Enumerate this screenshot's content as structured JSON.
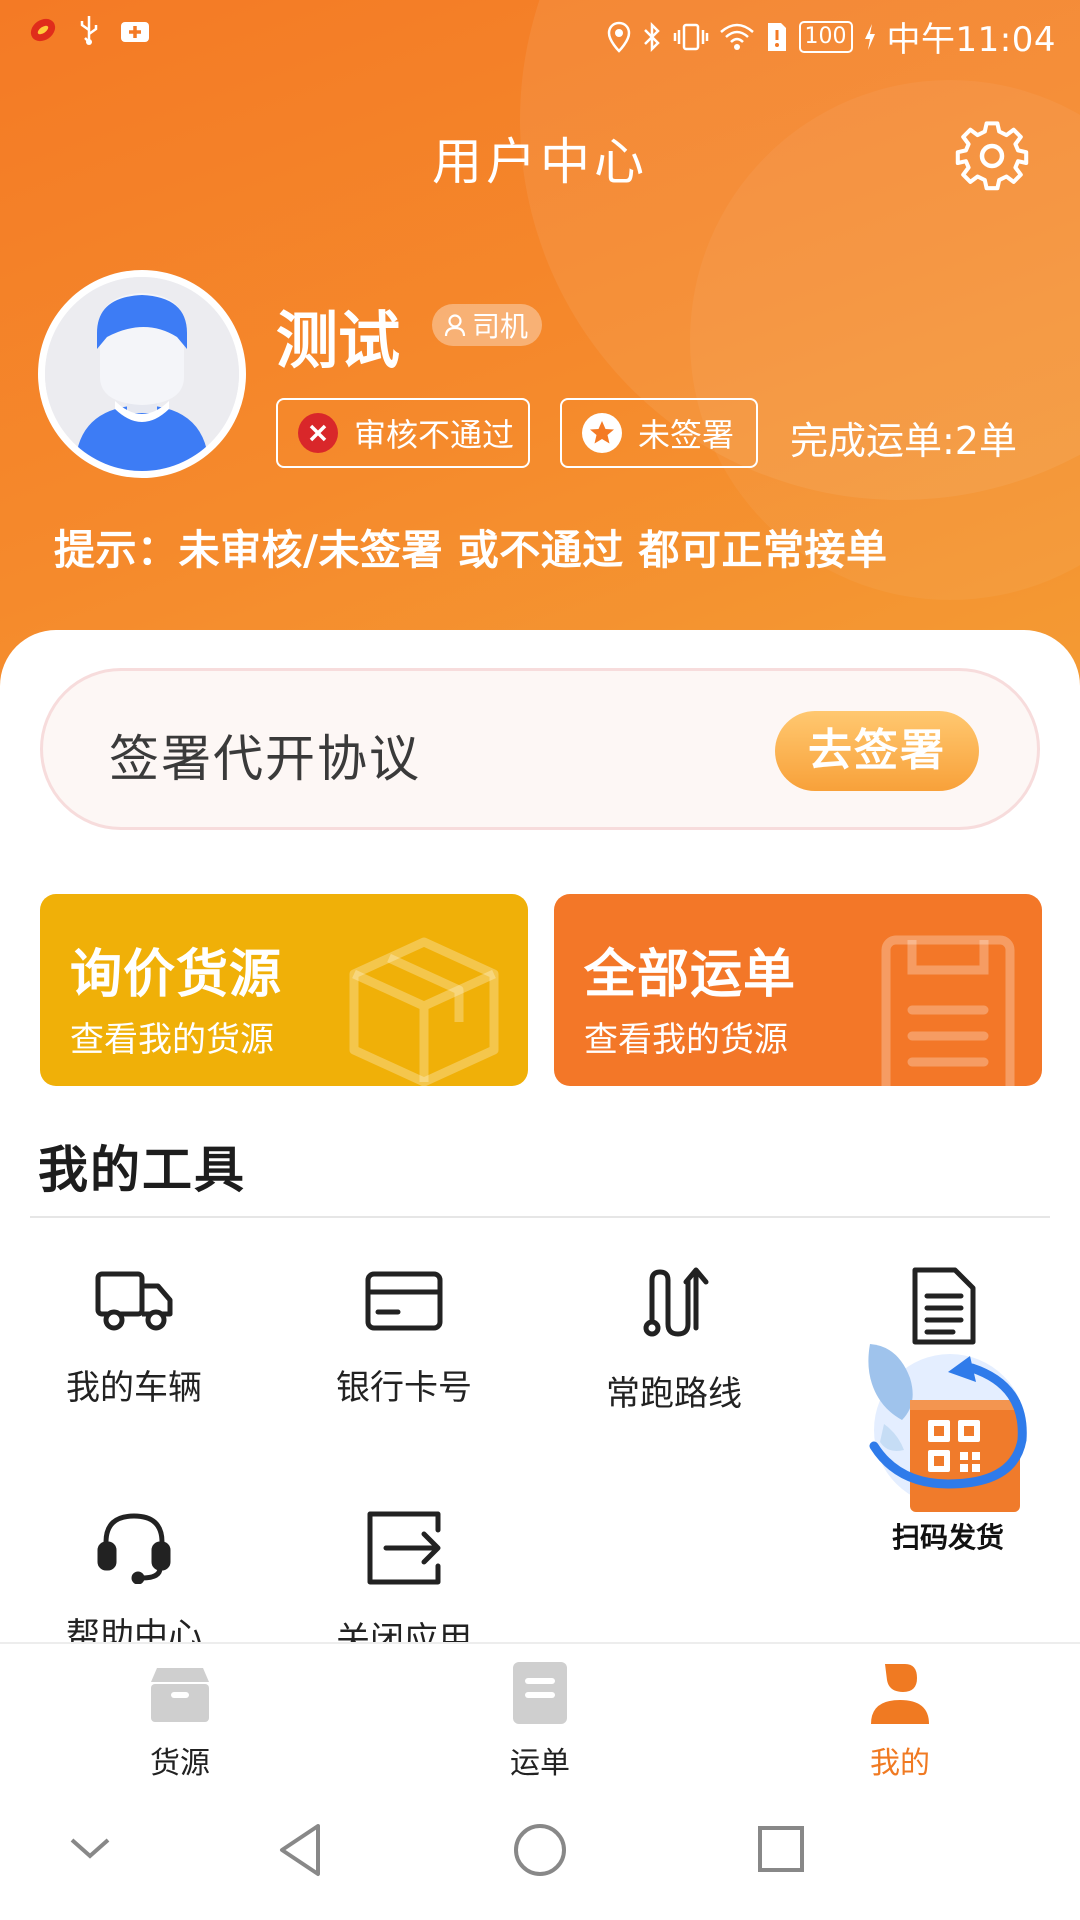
{
  "status_bar": {
    "battery": "100",
    "time": "中午11:04"
  },
  "header": {
    "title": "用户中心"
  },
  "profile": {
    "name": "测试",
    "role": "司机",
    "review_status": "审核不通过",
    "sign_status": "未签署",
    "completed_orders": "完成运单:2单",
    "tip": "提示：未审核/未签署 或不通过 都可正常接单"
  },
  "agreement": {
    "label": "签署代开协议",
    "button": "去签署"
  },
  "cards": [
    {
      "title": "询价货源",
      "subtitle": "查看我的货源",
      "icon": "box-icon"
    },
    {
      "title": "全部运单",
      "subtitle": "查看我的货源",
      "icon": "clipboard-icon"
    }
  ],
  "tools": {
    "title": "我的工具",
    "items": [
      {
        "label": "我的车辆",
        "icon": "truck-icon"
      },
      {
        "label": "银行卡号",
        "icon": "bank-card-icon"
      },
      {
        "label": "常跑路线",
        "icon": "route-icon"
      },
      {
        "label": "",
        "icon": "document-icon"
      },
      {
        "label": "帮助中心",
        "icon": "headset-icon"
      },
      {
        "label": "关闭应用",
        "icon": "exit-icon"
      }
    ]
  },
  "scan_button": {
    "label": "扫码发货",
    "icon": "qr-code-icon"
  },
  "tabbar": [
    {
      "label": "货源",
      "icon": "cargo-box-icon",
      "active": false
    },
    {
      "label": "运单",
      "icon": "waybill-icon",
      "active": false
    },
    {
      "label": "我的",
      "icon": "user-icon",
      "active": true
    }
  ],
  "colors": {
    "brand_orange": "#f47a25",
    "card_yellow": "#f0b008",
    "card_orange": "#f37728",
    "error_red": "#d9272a",
    "active_tab": "#f07a22"
  }
}
